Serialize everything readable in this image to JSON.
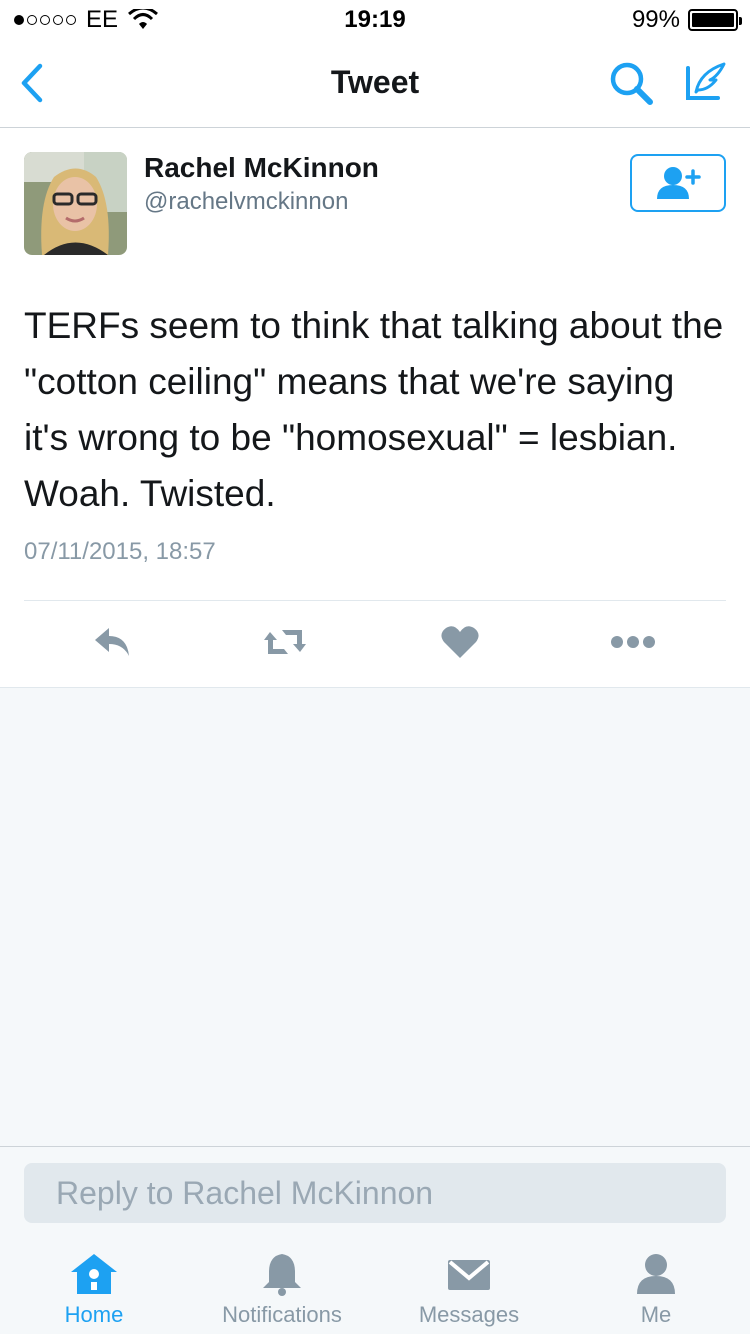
{
  "status_bar": {
    "carrier": "EE",
    "time": "19:19",
    "battery_percent": "99%",
    "battery_level": 0.99,
    "signal_filled": 1,
    "signal_total": 5
  },
  "nav": {
    "title": "Tweet",
    "back_icon": "chevron-left-icon",
    "search_icon": "search-icon",
    "compose_icon": "compose-tweet-icon"
  },
  "tweet": {
    "author_name": "Rachel McKinnon",
    "author_handle": "@rachelvmckinnon",
    "text": "TERFs seem to think that talking about the \"cotton ceiling\" means that we're saying it's wrong to be \"homosexual\" = lesbian. Woah. Twisted.",
    "timestamp": "07/11/2015, 18:57",
    "actions": [
      "reply-icon",
      "retweet-icon",
      "like-icon",
      "more-icon"
    ]
  },
  "reply": {
    "placeholder": "Reply to Rachel McKinnon"
  },
  "tabs": [
    {
      "label": "Home",
      "icon": "home-icon",
      "active": true
    },
    {
      "label": "Notifications",
      "icon": "bell-icon",
      "active": false
    },
    {
      "label": "Messages",
      "icon": "envelope-icon",
      "active": false
    },
    {
      "label": "Me",
      "icon": "person-icon",
      "active": false
    }
  ],
  "colors": {
    "accent": "#1da1f2",
    "icon_gray": "#8899a6",
    "text": "#14171a",
    "background": "#f5f8fa"
  }
}
